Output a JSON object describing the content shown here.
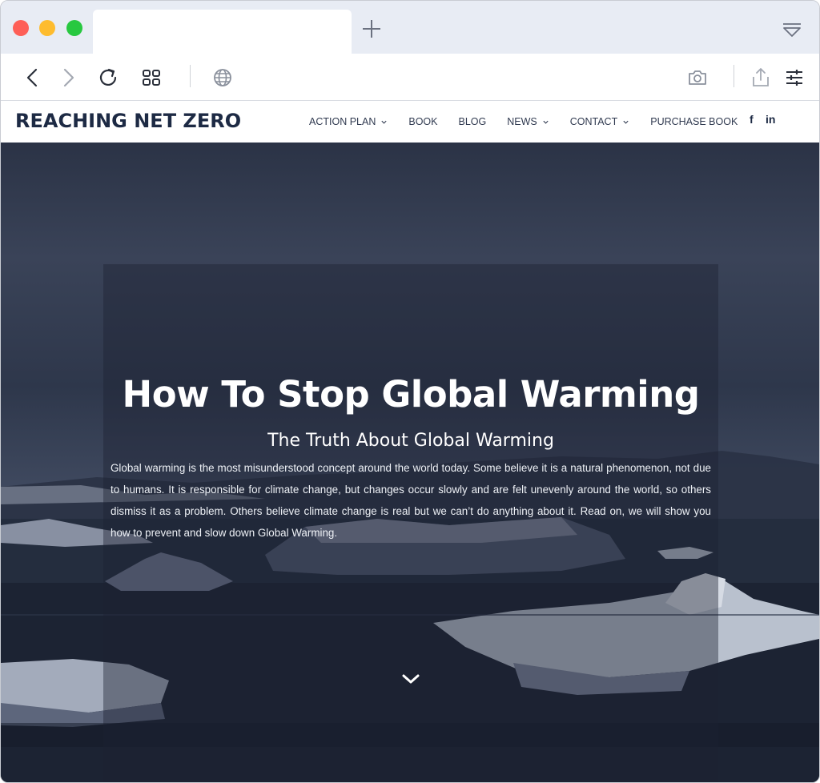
{
  "browser": {
    "traffic_lights": {
      "close": "#fe5f57",
      "minimize": "#febc2e",
      "maximize": "#28c840"
    },
    "toolbar_icons": [
      "back-icon",
      "forward-icon",
      "reload-icon",
      "tab-grid-icon",
      "globe-icon",
      "camera-icon",
      "share-icon",
      "settings-sliders-icon"
    ]
  },
  "site": {
    "logo": "REACHING NET ZERO",
    "nav": [
      {
        "label": "ACTION PLAN",
        "has_dropdown": true
      },
      {
        "label": "BOOK",
        "has_dropdown": false
      },
      {
        "label": "BLOG",
        "has_dropdown": false
      },
      {
        "label": "NEWS",
        "has_dropdown": true
      },
      {
        "label": "CONTACT",
        "has_dropdown": true
      },
      {
        "label": "PURCHASE BOOK",
        "has_dropdown": false
      }
    ],
    "social": {
      "facebook": "f",
      "linkedin": "in"
    }
  },
  "hero": {
    "title": "How To Stop Global Warming",
    "subtitle": "The Truth About Global Warming",
    "body": "Global warming is the most misunderstood concept around the world today. Some believe it is a natural phenomenon, not due to humans. It is responsible for climate change, but changes occur slowly and are felt unevenly around the world, so others dismiss it as a problem. Others believe climate change is real but we can’t do anything about it. Read on, we will show you how to prevent and slow down Global Warming."
  },
  "colors": {
    "brand_text": "#1d2a44",
    "nav_text": "#303a50",
    "hero_overlay": "#1c2232",
    "tab_bar": "#e8ecf4"
  }
}
